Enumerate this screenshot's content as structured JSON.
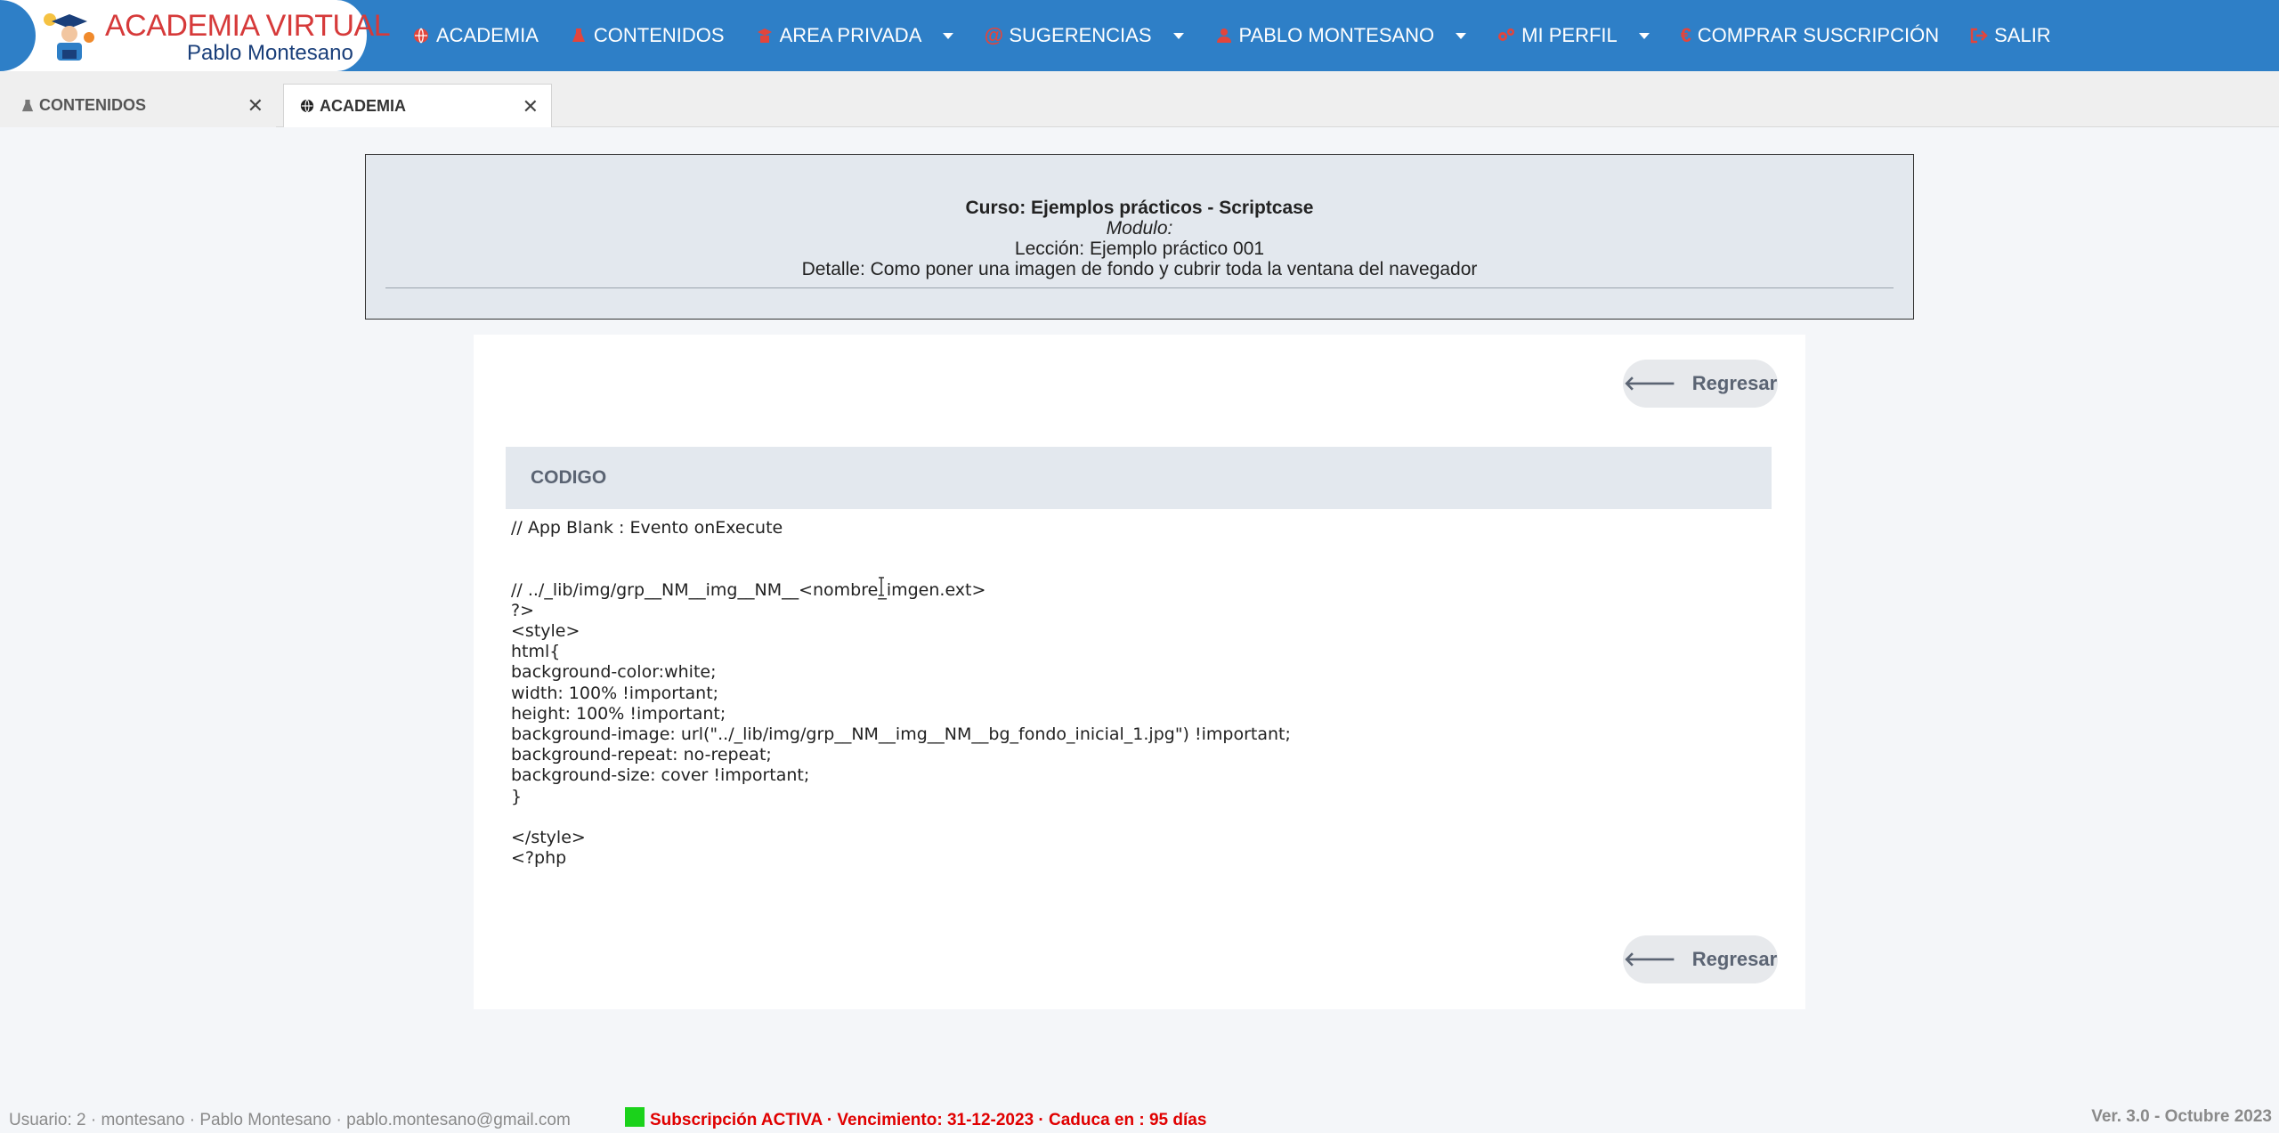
{
  "brand": {
    "title": "ACADEMIA VIRTUAL",
    "subtitle": "Pablo Montesano",
    "accent_color": "#2e7fc7",
    "title_color": "#d63a3a"
  },
  "nav": {
    "items": [
      {
        "label": "ACADEMIA",
        "icon": "globe-icon"
      },
      {
        "label": "CONTENIDOS",
        "icon": "flask-icon"
      },
      {
        "label": "AREA PRIVADA",
        "icon": "graduate-icon",
        "dropdown": true
      },
      {
        "label": "SUGERENCIAS",
        "icon": "at-icon",
        "dropdown": true
      },
      {
        "label": "PABLO MONTESANO",
        "icon": "user-icon",
        "dropdown": true
      },
      {
        "label": "MI PERFIL",
        "icon": "gears-icon",
        "dropdown": true
      },
      {
        "label": "COMPRAR SUSCRIPCIÓN",
        "icon": "euro-icon"
      },
      {
        "label": "SALIR",
        "icon": "sign-out-icon"
      }
    ]
  },
  "tabs": [
    {
      "label": "CONTENIDOS",
      "icon": "flask-icon",
      "active": false
    },
    {
      "label": "ACADEMIA",
      "icon": "globe-icon",
      "active": true
    }
  ],
  "course": {
    "title": "Curso: Ejemplos prácticos - Scriptcase",
    "module": "Modulo:",
    "lesson": "Lección: Ejemplo práctico 001",
    "detail": "Detalle: Como poner una imagen de fondo y cubrir toda la ventana del navegador"
  },
  "actions": {
    "back_label": "Regresar"
  },
  "code": {
    "header": "CODIGO",
    "content": "// App Blank : Evento onExecute\n\n\n// ../_lib/img/grp__NM__img__NM__<nombre_imgen.ext>\n?>\n<style>\nhtml{\nbackground-color:white;\nwidth: 100% !important;\nheight: 100% !important;\nbackground-image: url(\"../_lib/img/grp__NM__img__NM__bg_fondo_inicial_1.jpg\") !important;\nbackground-repeat: no-repeat;\nbackground-size: cover !important;\n}\n\n</style>\n<?php"
  },
  "footer": {
    "user": "Usuario: 2 · montesano · Pablo Montesano · pablo.montesano@gmail.com",
    "subscription": "Subscripción ACTIVA · Vencimiento: 31-12-2023 · Caduca en : 95 días",
    "version": "Ver. 3.0 - Octubre 2023",
    "status_color": "#1bd21b"
  }
}
